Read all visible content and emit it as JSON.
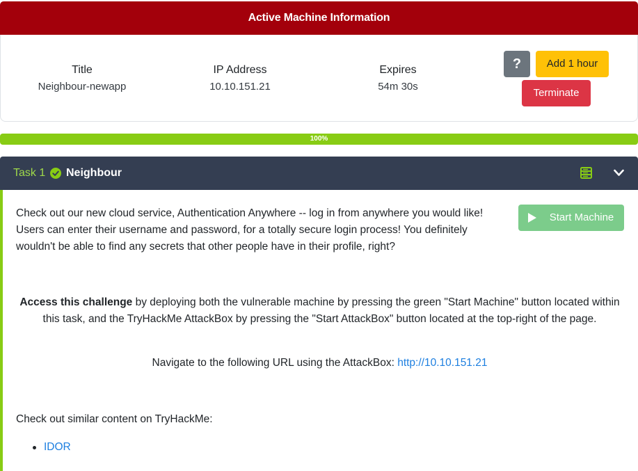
{
  "machine_panel": {
    "heading": "Active Machine Information",
    "fields": [
      {
        "label": "Title",
        "value": "Neighbour-newapp"
      },
      {
        "label": "IP Address",
        "value": "10.10.151.21"
      },
      {
        "label": "Expires",
        "value": "54m 30s"
      }
    ],
    "help_label": "?",
    "add_hour_label": "Add 1 hour",
    "terminate_label": "Terminate"
  },
  "progress": {
    "label": "100%",
    "value": 1.0
  },
  "task": {
    "number_label": "Task 1",
    "title": "Neighbour",
    "completed": true,
    "intro": "Check out our new cloud service, Authentication Anywhere -- log in from anywhere you would like! Users can enter their username and password, for a totally secure login process! You definitely wouldn't be able to find any secrets that other people have in their profile, right?",
    "start_machine_label": "Start Machine",
    "access_strong": "Access this challenge",
    "access_rest": " by deploying both the vulnerable machine by pressing the green \"Start Machine\" button located within this task, and the TryHackMe AttackBox by pressing the  \"Start AttackBox\" button located at the top-right of the page.",
    "navigate_text": "Navigate to the following URL using the AttackBox: ",
    "navigate_link": "http://10.10.151.21",
    "similar_text": "Check out similar content on TryHackMe:",
    "related": [
      "IDOR"
    ]
  },
  "icons": {
    "task_status": "check-circle-icon",
    "task_resources": "server-icon",
    "collapse": "chevron-down-icon",
    "start": "play-icon"
  },
  "colors": {
    "header_red": "#a3000b",
    "progress_green": "#88cc14",
    "task_header": "#343e52",
    "add_hour_yellow": "#ffc107",
    "terminate_red": "#dc3545",
    "help_gray": "#6c757d",
    "start_green": "#7ccc8b",
    "link_blue": "#1d7fe0"
  }
}
